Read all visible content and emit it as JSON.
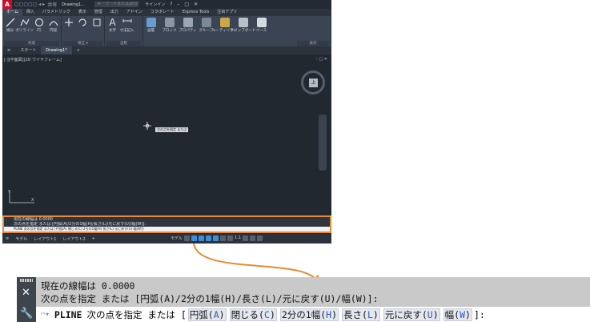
{
  "titlebar": {
    "logo": "A",
    "file": "Drawing1...",
    "search_placeholder": "キーワードまたは語句を入力",
    "share": "共有",
    "signin": "サインイン"
  },
  "ribbon_tabs": [
    "ホーム",
    "挿入",
    "パラメトリック",
    "表示",
    "管理",
    "出力",
    "アドイン",
    "コラボレート",
    "Express Tools",
    "注目アプリ"
  ],
  "ribbon_groups": [
    {
      "label": "作成",
      "tools": [
        "線分",
        "ポリライン",
        "円",
        "円弧"
      ]
    },
    {
      "label": "修正",
      "tools": [
        "",
        "",
        ""
      ]
    },
    {
      "label": "注釈",
      "tools": [
        "文字",
        "寸法記入",
        ""
      ]
    },
    {
      "label": "",
      "tools": [
        "画層",
        "ブロック",
        "プロパティ",
        "グループ",
        "ユーティリティ",
        "クリップボード",
        "ベース"
      ]
    },
    {
      "label": "表示",
      "tools": []
    }
  ],
  "doc_tabs": [
    "スタート",
    "Drawing1*"
  ],
  "viewport_label": "[-][平面図][2D ワイヤフレーム]",
  "viewcube_label": "上",
  "cursor_tooltip": "次の点を指定 または",
  "ucs": {
    "y": "Y",
    "x": "X"
  },
  "cmd_small": {
    "line1": "現在の線幅は 0.0000",
    "line2": "次の点を指定 または [円弧(A)/2分の1幅(H)/長さ(L)/元に戻す(U)/幅(W)]:",
    "input": "PLINE 次の点を指定 または [円弧(A) 閉じる(C) 2分の1幅(H) 長さ(L) 元に戻す(U) 幅(W)]:"
  },
  "status": {
    "model": "モデル",
    "layout1": "レイアウト1",
    "layout2": "レイアウト2",
    "model_right": "モデル",
    "scale": "1:1"
  },
  "zoom": {
    "line1": "現在の線幅は 0.0000",
    "line2": "次の点を指定 または [円弧(A)/2分の1幅(H)/長さ(L)/元に戻す(U)/幅(W)]:",
    "command": "PLINE",
    "prompt": "次の点を指定 または [",
    "options": [
      {
        "label": "円弧(",
        "key": "A",
        "close": ")"
      },
      {
        "label": "閉じる(",
        "key": "C",
        "close": ")"
      },
      {
        "label": "2分の1幅(",
        "key": "H",
        "close": ")"
      },
      {
        "label": "長さ(",
        "key": "L",
        "close": ")"
      },
      {
        "label": "元に戻す(",
        "key": "U",
        "close": ")"
      },
      {
        "label": "幅(",
        "key": "W",
        "close": ")"
      }
    ],
    "end": "]:"
  },
  "colors": {
    "accent_orange": "#e88a31",
    "brand_red": "#c8102e",
    "key_blue": "#2a55c8"
  }
}
